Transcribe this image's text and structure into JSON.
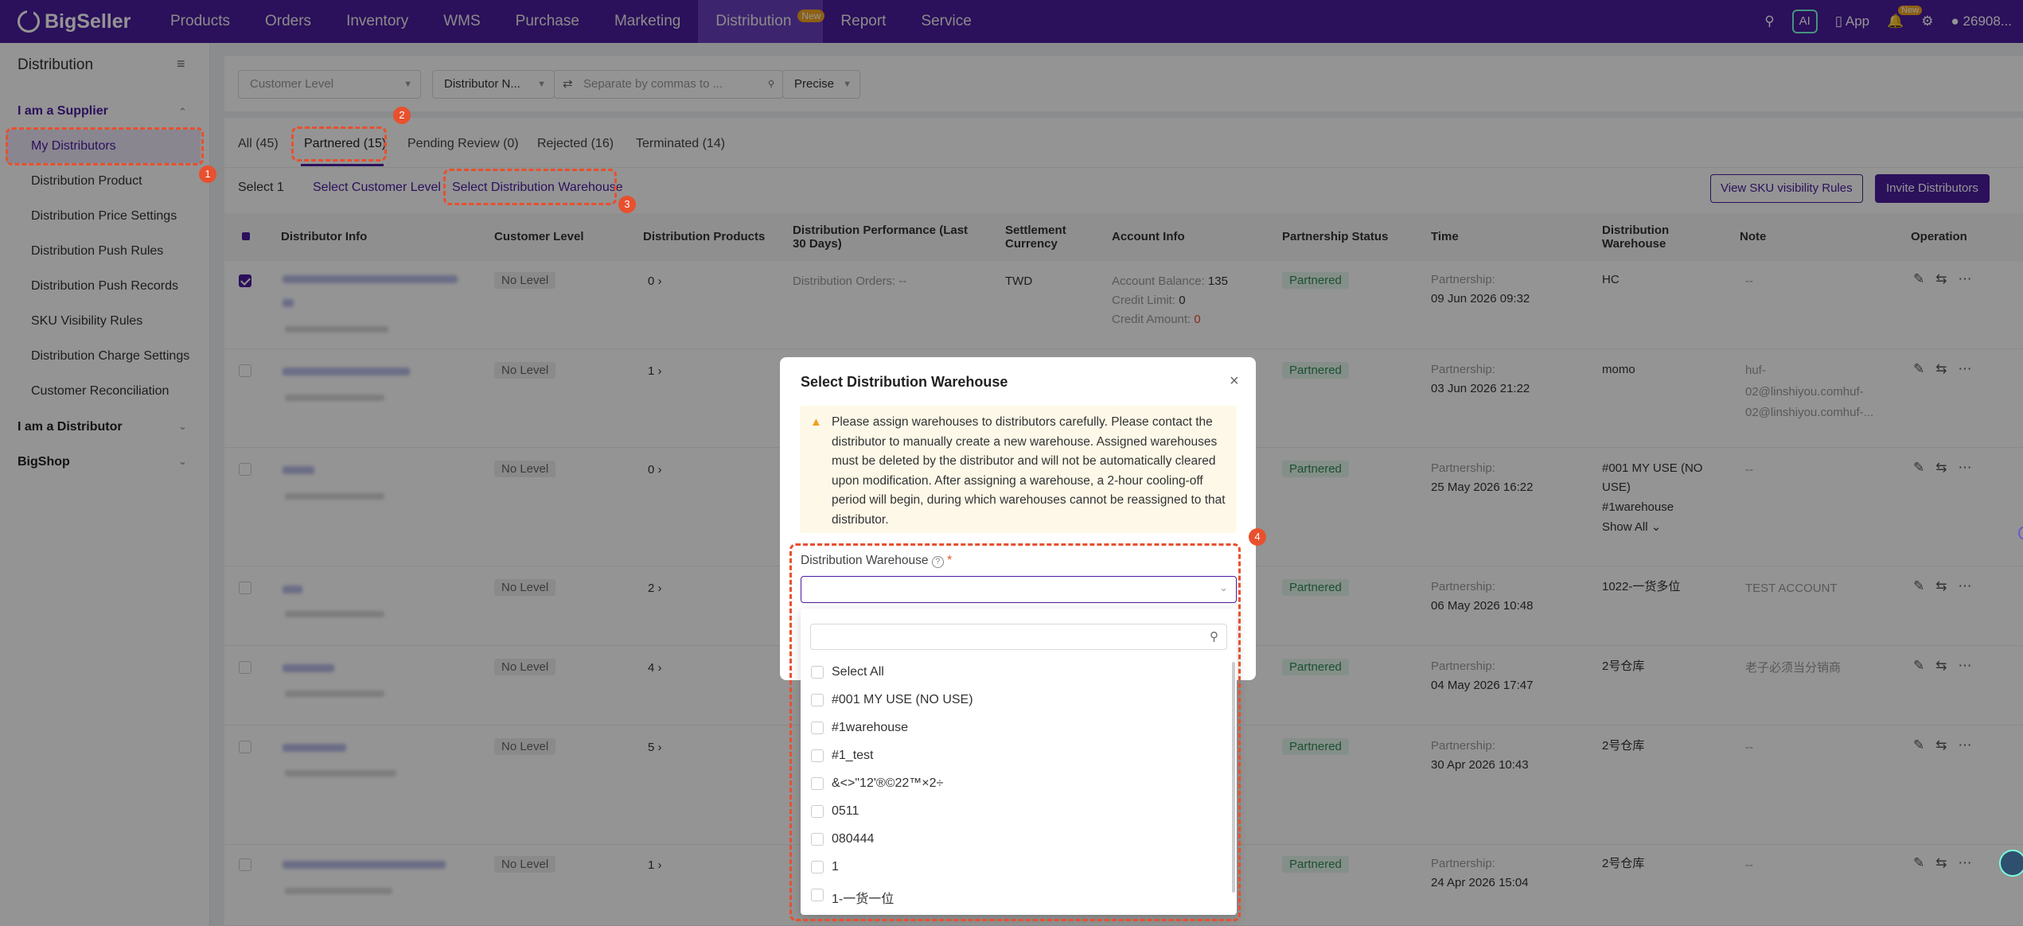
{
  "nav": {
    "logo": "BigSeller",
    "items": [
      {
        "label": "Products"
      },
      {
        "label": "Orders"
      },
      {
        "label": "Inventory"
      },
      {
        "label": "WMS"
      },
      {
        "label": "Purchase"
      },
      {
        "label": "Marketing"
      },
      {
        "label": "Distribution",
        "badge": "New"
      },
      {
        "label": "Report"
      },
      {
        "label": "Service"
      }
    ],
    "ai": "AI",
    "app": "App",
    "notif_badge": "New",
    "user": "26908..."
  },
  "sidebar": {
    "title": "Distribution",
    "group_supplier": "I am a Supplier",
    "items": [
      "My Distributors",
      "Distribution Product",
      "Distribution Price Settings",
      "Distribution Push Rules",
      "Distribution Push Records",
      "SKU Visibility Rules",
      "Distribution Charge Settings",
      "Customer Reconciliation"
    ],
    "group_distributor": "I am a Distributor",
    "group_bigshop": "BigShop"
  },
  "filters": {
    "customer_level": "Customer Level",
    "distributor_select": "Distributor N...",
    "search_placeholder": "Separate by commas to ...",
    "match_mode": "Precise"
  },
  "tabs": [
    "All (45)",
    "Partnered (15)",
    "Pending Review (0)",
    "Rejected (16)",
    "Terminated (14)"
  ],
  "actions": {
    "selected": "Select 1",
    "select_customer_level": "Select Customer Level",
    "select_distribution_warehouse": "Select Distribution Warehouse",
    "view_sku_rules": "View SKU visibility Rules",
    "invite": "Invite Distributors"
  },
  "table": {
    "headers": {
      "distributor_info": "Distributor Info",
      "customer_level": "Customer Level",
      "distribution_products": "Distribution Products",
      "performance": "Distribution Performance (Last 30 Days)",
      "currency": "Settlement Currency",
      "account": "Account Info",
      "status": "Partnership Status",
      "time": "Time",
      "warehouse": "Distribution Warehouse",
      "note": "Note",
      "operation": "Operation"
    },
    "rows": [
      {
        "level": "No Level",
        "products": "0",
        "orders": "Distribution Orders: --",
        "currency": "TWD",
        "balance_label": "Account Balance:",
        "balance": "135",
        "credit_label": "Credit Limit:",
        "credit": "0",
        "credit_amt_label": "Credit Amount:",
        "credit_amt": "0",
        "status": "Partnered",
        "time_label": "Partnership:",
        "time": "09 Jun 2026 09:32",
        "warehouse": "HC",
        "note": "--"
      },
      {
        "level": "No Level",
        "products": "1",
        "status": "Partnered",
        "time_label": "Partnership:",
        "time": "03 Jun 2026 21:22",
        "warehouse": "momo",
        "note1": "huf-",
        "note2": "02@linshiyou.comhuf-",
        "note3": "02@linshiyou.comhuf-..."
      },
      {
        "level": "No Level",
        "products": "0",
        "status": "Partnered",
        "time_label": "Partnership:",
        "time": "25 May 2026 16:22",
        "warehouse1": "#001 MY USE (NO",
        "warehouse2": "USE)",
        "warehouse3": "#1warehouse",
        "show_all": "Show All",
        "note": "--"
      },
      {
        "level": "No Level",
        "products": "2",
        "status": "Partnered",
        "time_label": "Partnership:",
        "time": "06 May 2026 10:48",
        "warehouse": "1022-一货多位",
        "note": "TEST ACCOUNT"
      },
      {
        "level": "No Level",
        "products": "4",
        "status": "Partnered",
        "time_label": "Partnership:",
        "time": "04 May 2026 17:47",
        "warehouse": "2号仓库",
        "note": "老子必须当分销商"
      },
      {
        "level": "No Level",
        "products": "5",
        "status": "Partnered",
        "time_label": "Partnership:",
        "time": "30 Apr 2026 10:43",
        "warehouse": "2号仓库",
        "note": "--"
      },
      {
        "level": "No Level",
        "products": "1",
        "status": "Partnered",
        "time_label": "Partnership:",
        "time": "24 Apr 2026 15:04",
        "warehouse": "2号仓库",
        "note": "--"
      }
    ]
  },
  "modal": {
    "title": "Select Distribution Warehouse",
    "warning": "Please assign warehouses to distributors carefully. Please contact the distributor to manually create a new warehouse. Assigned warehouses must be deleted by the distributor and will not be automatically cleared upon modification. After assigning a warehouse, a 2-hour cooling-off period will begin, during which warehouses cannot be reassigned to that distributor.",
    "field_label": "Distribution Warehouse",
    "required_mark": "*",
    "options": [
      "Select All",
      "#001 MY USE (NO USE)",
      "#1warehouse",
      "#1_test",
      "&<>\"12'®©22™×2÷",
      "0511",
      "080444",
      "1",
      "1-一货一位"
    ]
  },
  "annotations": [
    "1",
    "2",
    "3",
    "4"
  ],
  "colors": {
    "brand": "#4b1c9e",
    "annotation": "#e8502e",
    "partnered_bg": "#e6f7ec",
    "partnered_text": "#2e8b57"
  }
}
